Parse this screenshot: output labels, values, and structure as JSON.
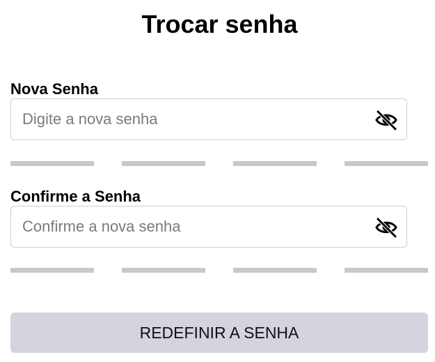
{
  "page": {
    "title": "Trocar senha"
  },
  "new_password": {
    "label": "Nova Senha",
    "value": "",
    "placeholder": "Digite a nova senha",
    "toggle_icon": "eye-slash-icon"
  },
  "confirm_password": {
    "label": "Confirme a Senha",
    "value": "",
    "placeholder": "Confirme a nova senha",
    "toggle_icon": "eye-slash-icon"
  },
  "strength_meter": {
    "segments": 4,
    "filled": 0,
    "empty_color": "#c8c8c8"
  },
  "submit": {
    "label": "REDEFINIR A SENHA",
    "background": "#d4d4de"
  }
}
